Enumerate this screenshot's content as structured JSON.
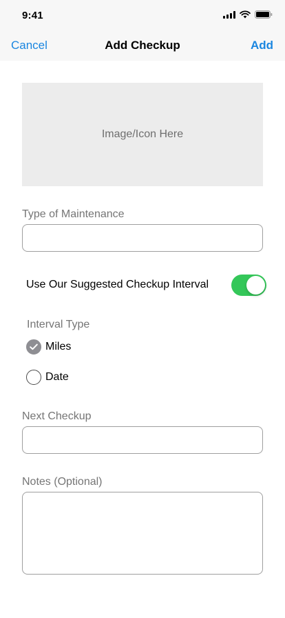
{
  "status_bar": {
    "time": "9:41",
    "icons": [
      "signal-icon",
      "wifi-icon",
      "battery-icon"
    ]
  },
  "nav": {
    "cancel_label": "Cancel",
    "title": "Add Checkup",
    "add_label": "Add"
  },
  "image_placeholder": {
    "text": "Image/Icon Here"
  },
  "maintenance_type": {
    "label": "Type of Maintenance",
    "value": "",
    "placeholder": ""
  },
  "suggested_interval": {
    "label": "Use Our Suggested Checkup Interval",
    "enabled": true
  },
  "interval_type": {
    "label": "Interval Type",
    "options": [
      {
        "label": "Miles",
        "selected": true
      },
      {
        "label": "Date",
        "selected": false
      }
    ]
  },
  "next_checkup": {
    "label": "Next Checkup",
    "value": "",
    "placeholder": ""
  },
  "notes": {
    "label": "Notes (Optional)",
    "value": "",
    "placeholder": ""
  },
  "colors": {
    "accent": "#1a86e0",
    "toggle_on": "#34c759",
    "placeholder_bg": "#ececec"
  }
}
